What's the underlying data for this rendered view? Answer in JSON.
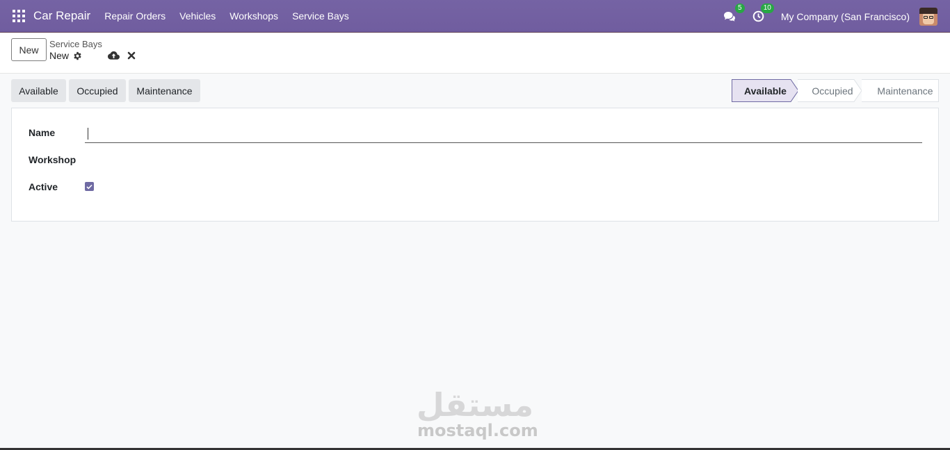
{
  "navbar": {
    "app_name": "Car Repair",
    "menu": [
      "Repair Orders",
      "Vehicles",
      "Workshops",
      "Service Bays"
    ],
    "messages_count": "5",
    "activities_count": "10",
    "company": "My Company (San Francisco)"
  },
  "control": {
    "new_label": "New",
    "breadcrumb_parent": "Service Bays",
    "breadcrumb_current": "New"
  },
  "status_buttons": [
    "Available",
    "Occupied",
    "Maintenance"
  ],
  "statusbar": {
    "stages": [
      "Available",
      "Occupied",
      "Maintenance"
    ],
    "active": "Available"
  },
  "form": {
    "name_label": "Name",
    "name_value": "",
    "workshop_label": "Workshop",
    "active_label": "Active",
    "active_checked": true
  },
  "watermark": {
    "arabic": "مستقل",
    "latin": "mostaql.com"
  },
  "colors": {
    "navbar": "#7563a4",
    "accent": "#6f6aa3",
    "badge": "#28a745"
  }
}
